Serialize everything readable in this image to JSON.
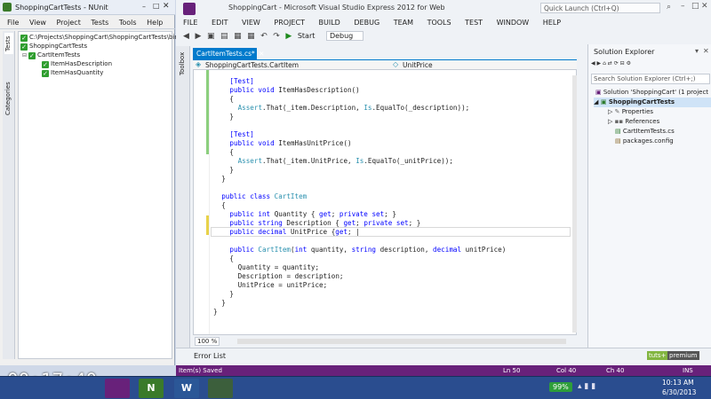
{
  "nunit": {
    "title": "ShoppingCartTests - NUnit",
    "menu": [
      "File",
      "View",
      "Project",
      "Tests",
      "Tools",
      "Help"
    ],
    "vertical_tabs": [
      "Tests",
      "Categories"
    ],
    "tree": [
      "C:\\Projects\\ShoppingCart\\ShoppingCartTests\\bin\\Debu",
      "ShoppingCartTests",
      "CartItemTests",
      "ItemHasDescription",
      "ItemHasQuantity"
    ]
  },
  "vs": {
    "title": "ShoppingCart - Microsoft Visual Studio Express 2012 for Web",
    "quick_launch": "Quick Launch (Ctrl+Q)",
    "menu": [
      "FILE",
      "EDIT",
      "VIEW",
      "PROJECT",
      "BUILD",
      "DEBUG",
      "TEAM",
      "TOOLS",
      "TEST",
      "WINDOW",
      "HELP"
    ],
    "start_label": "Start",
    "config": "Debug",
    "toolbox_label": "Toolbox",
    "doc_tab": "CartItemTests.cs*",
    "nav_left": "ShoppingCartTests.CartItem",
    "nav_right": "UnitPrice",
    "zoom": "100 %",
    "error_list": "Error List",
    "watermark_a": "tuts+",
    "watermark_b": "premium"
  },
  "code_lines": [
    {
      "n": 0,
      "parts": [
        [
          "k",
          "[Test]"
        ]
      ]
    },
    {
      "n": 1,
      "parts": [
        [
          "k",
          "public "
        ],
        [
          "k",
          "void "
        ],
        [
          "t",
          "ItemHasDescription()"
        ]
      ]
    },
    {
      "n": 2,
      "parts": [
        [
          "t",
          "{"
        ]
      ]
    },
    {
      "n": 3,
      "parts": [
        [
          "y",
          "Assert"
        ],
        [
          "t",
          ".That(_item.Description, "
        ],
        [
          "y",
          "Is"
        ],
        [
          "t",
          ".EqualTo(_description));"
        ]
      ]
    },
    {
      "n": 4,
      "parts": [
        [
          "t",
          "}"
        ]
      ]
    },
    {
      "n": 5,
      "parts": [
        [
          "t",
          ""
        ]
      ]
    },
    {
      "n": 6,
      "parts": [
        [
          "k",
          "[Test]"
        ]
      ]
    },
    {
      "n": 7,
      "parts": [
        [
          "k",
          "public "
        ],
        [
          "k",
          "void "
        ],
        [
          "t",
          "ItemHasUnitPrice()"
        ]
      ]
    },
    {
      "n": 8,
      "parts": [
        [
          "t",
          "{"
        ]
      ]
    },
    {
      "n": 9,
      "parts": [
        [
          "y",
          "Assert"
        ],
        [
          "t",
          ".That(_item.UnitPrice, "
        ],
        [
          "y",
          "Is"
        ],
        [
          "t",
          ".EqualTo(_unitPrice));"
        ]
      ]
    },
    {
      "n": 10,
      "parts": [
        [
          "t",
          "}"
        ]
      ]
    },
    {
      "n": 11,
      "parts": [
        [
          "t",
          "}"
        ]
      ]
    },
    {
      "n": 12,
      "parts": [
        [
          "t",
          ""
        ]
      ]
    },
    {
      "n": 13,
      "parts": [
        [
          "k",
          "public "
        ],
        [
          "k",
          "class "
        ],
        [
          "y",
          "CartItem"
        ]
      ]
    },
    {
      "n": 14,
      "parts": [
        [
          "t",
          "{"
        ]
      ]
    },
    {
      "n": 15,
      "parts": [
        [
          "k",
          "public "
        ],
        [
          "k",
          "int "
        ],
        [
          "t",
          "Quantity { "
        ],
        [
          "k",
          "get"
        ],
        [
          "t",
          "; "
        ],
        [
          "k",
          "private "
        ],
        [
          "k",
          "set"
        ],
        [
          "t",
          "; }"
        ]
      ]
    },
    {
      "n": 16,
      "parts": [
        [
          "k",
          "public "
        ],
        [
          "k",
          "string "
        ],
        [
          "t",
          "Description { "
        ],
        [
          "k",
          "get"
        ],
        [
          "t",
          "; "
        ],
        [
          "k",
          "private "
        ],
        [
          "k",
          "set"
        ],
        [
          "t",
          "; }"
        ]
      ]
    },
    {
      "n": 17,
      "parts": [
        [
          "k",
          "public "
        ],
        [
          "k",
          "decimal "
        ],
        [
          "t",
          "UnitPrice {"
        ],
        [
          "k",
          "get"
        ],
        [
          "t",
          "; |"
        ]
      ]
    },
    {
      "n": 18,
      "parts": [
        [
          "t",
          ""
        ]
      ]
    },
    {
      "n": 19,
      "parts": [
        [
          "k",
          "public "
        ],
        [
          "y",
          "CartItem"
        ],
        [
          "t",
          "("
        ],
        [
          "k",
          "int "
        ],
        [
          "t",
          "quantity, "
        ],
        [
          "k",
          "string "
        ],
        [
          "t",
          "description, "
        ],
        [
          "k",
          "decimal "
        ],
        [
          "t",
          "unitPrice)"
        ]
      ]
    },
    {
      "n": 20,
      "parts": [
        [
          "t",
          "{"
        ]
      ]
    },
    {
      "n": 21,
      "parts": [
        [
          "t",
          "Quantity = quantity;"
        ]
      ]
    },
    {
      "n": 22,
      "parts": [
        [
          "t",
          "Description = description;"
        ]
      ]
    },
    {
      "n": 23,
      "parts": [
        [
          "t",
          "UnitPrice = unitPrice;"
        ]
      ]
    },
    {
      "n": 24,
      "parts": [
        [
          "t",
          "}"
        ]
      ]
    },
    {
      "n": 25,
      "parts": [
        [
          "t",
          "}"
        ]
      ]
    },
    {
      "n": 26,
      "parts": [
        [
          "t",
          "}"
        ]
      ]
    }
  ],
  "solution_explorer": {
    "title": "Solution Explorer",
    "search_placeholder": "Search Solution Explorer (Ctrl+;)",
    "items": [
      "Solution 'ShoppingCart' (1 project",
      "ShoppingCartTests",
      "Properties",
      "References",
      "CartItemTests.cs",
      "packages.config"
    ]
  },
  "status": {
    "message": "Item(s) Saved",
    "ln": "Ln 50",
    "col": "Col 40",
    "ch": "Ch 40",
    "mode": "INS"
  },
  "taskbar": {
    "timer": "00:17:40",
    "battery": "99%",
    "time": "10:13 AM",
    "date": "6/30/2013",
    "apps": [
      "visual-studio",
      "nunit",
      "word",
      "terminal"
    ]
  },
  "colors": {
    "status_bar": "#68217a",
    "keyword": "#0000ff",
    "type": "#2b91af",
    "accent": "#68217a"
  }
}
